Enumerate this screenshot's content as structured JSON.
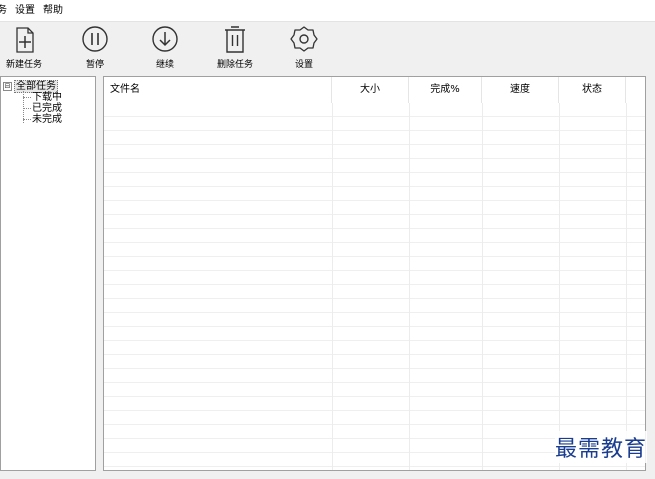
{
  "menubar": {
    "items": [
      "务",
      "设置",
      "帮助"
    ]
  },
  "toolbar": {
    "new_task": "新建任务",
    "pause": "暂停",
    "resume": "继续",
    "delete_task": "删除任务",
    "settings": "设置"
  },
  "tree": {
    "root": "全部任务",
    "toggle": "⊟",
    "children": [
      "下载中",
      "已完成",
      "未完成"
    ]
  },
  "table": {
    "columns": [
      "文件名",
      "大小",
      "完成%",
      "速度",
      "状态"
    ]
  },
  "watermark": "最需教育"
}
